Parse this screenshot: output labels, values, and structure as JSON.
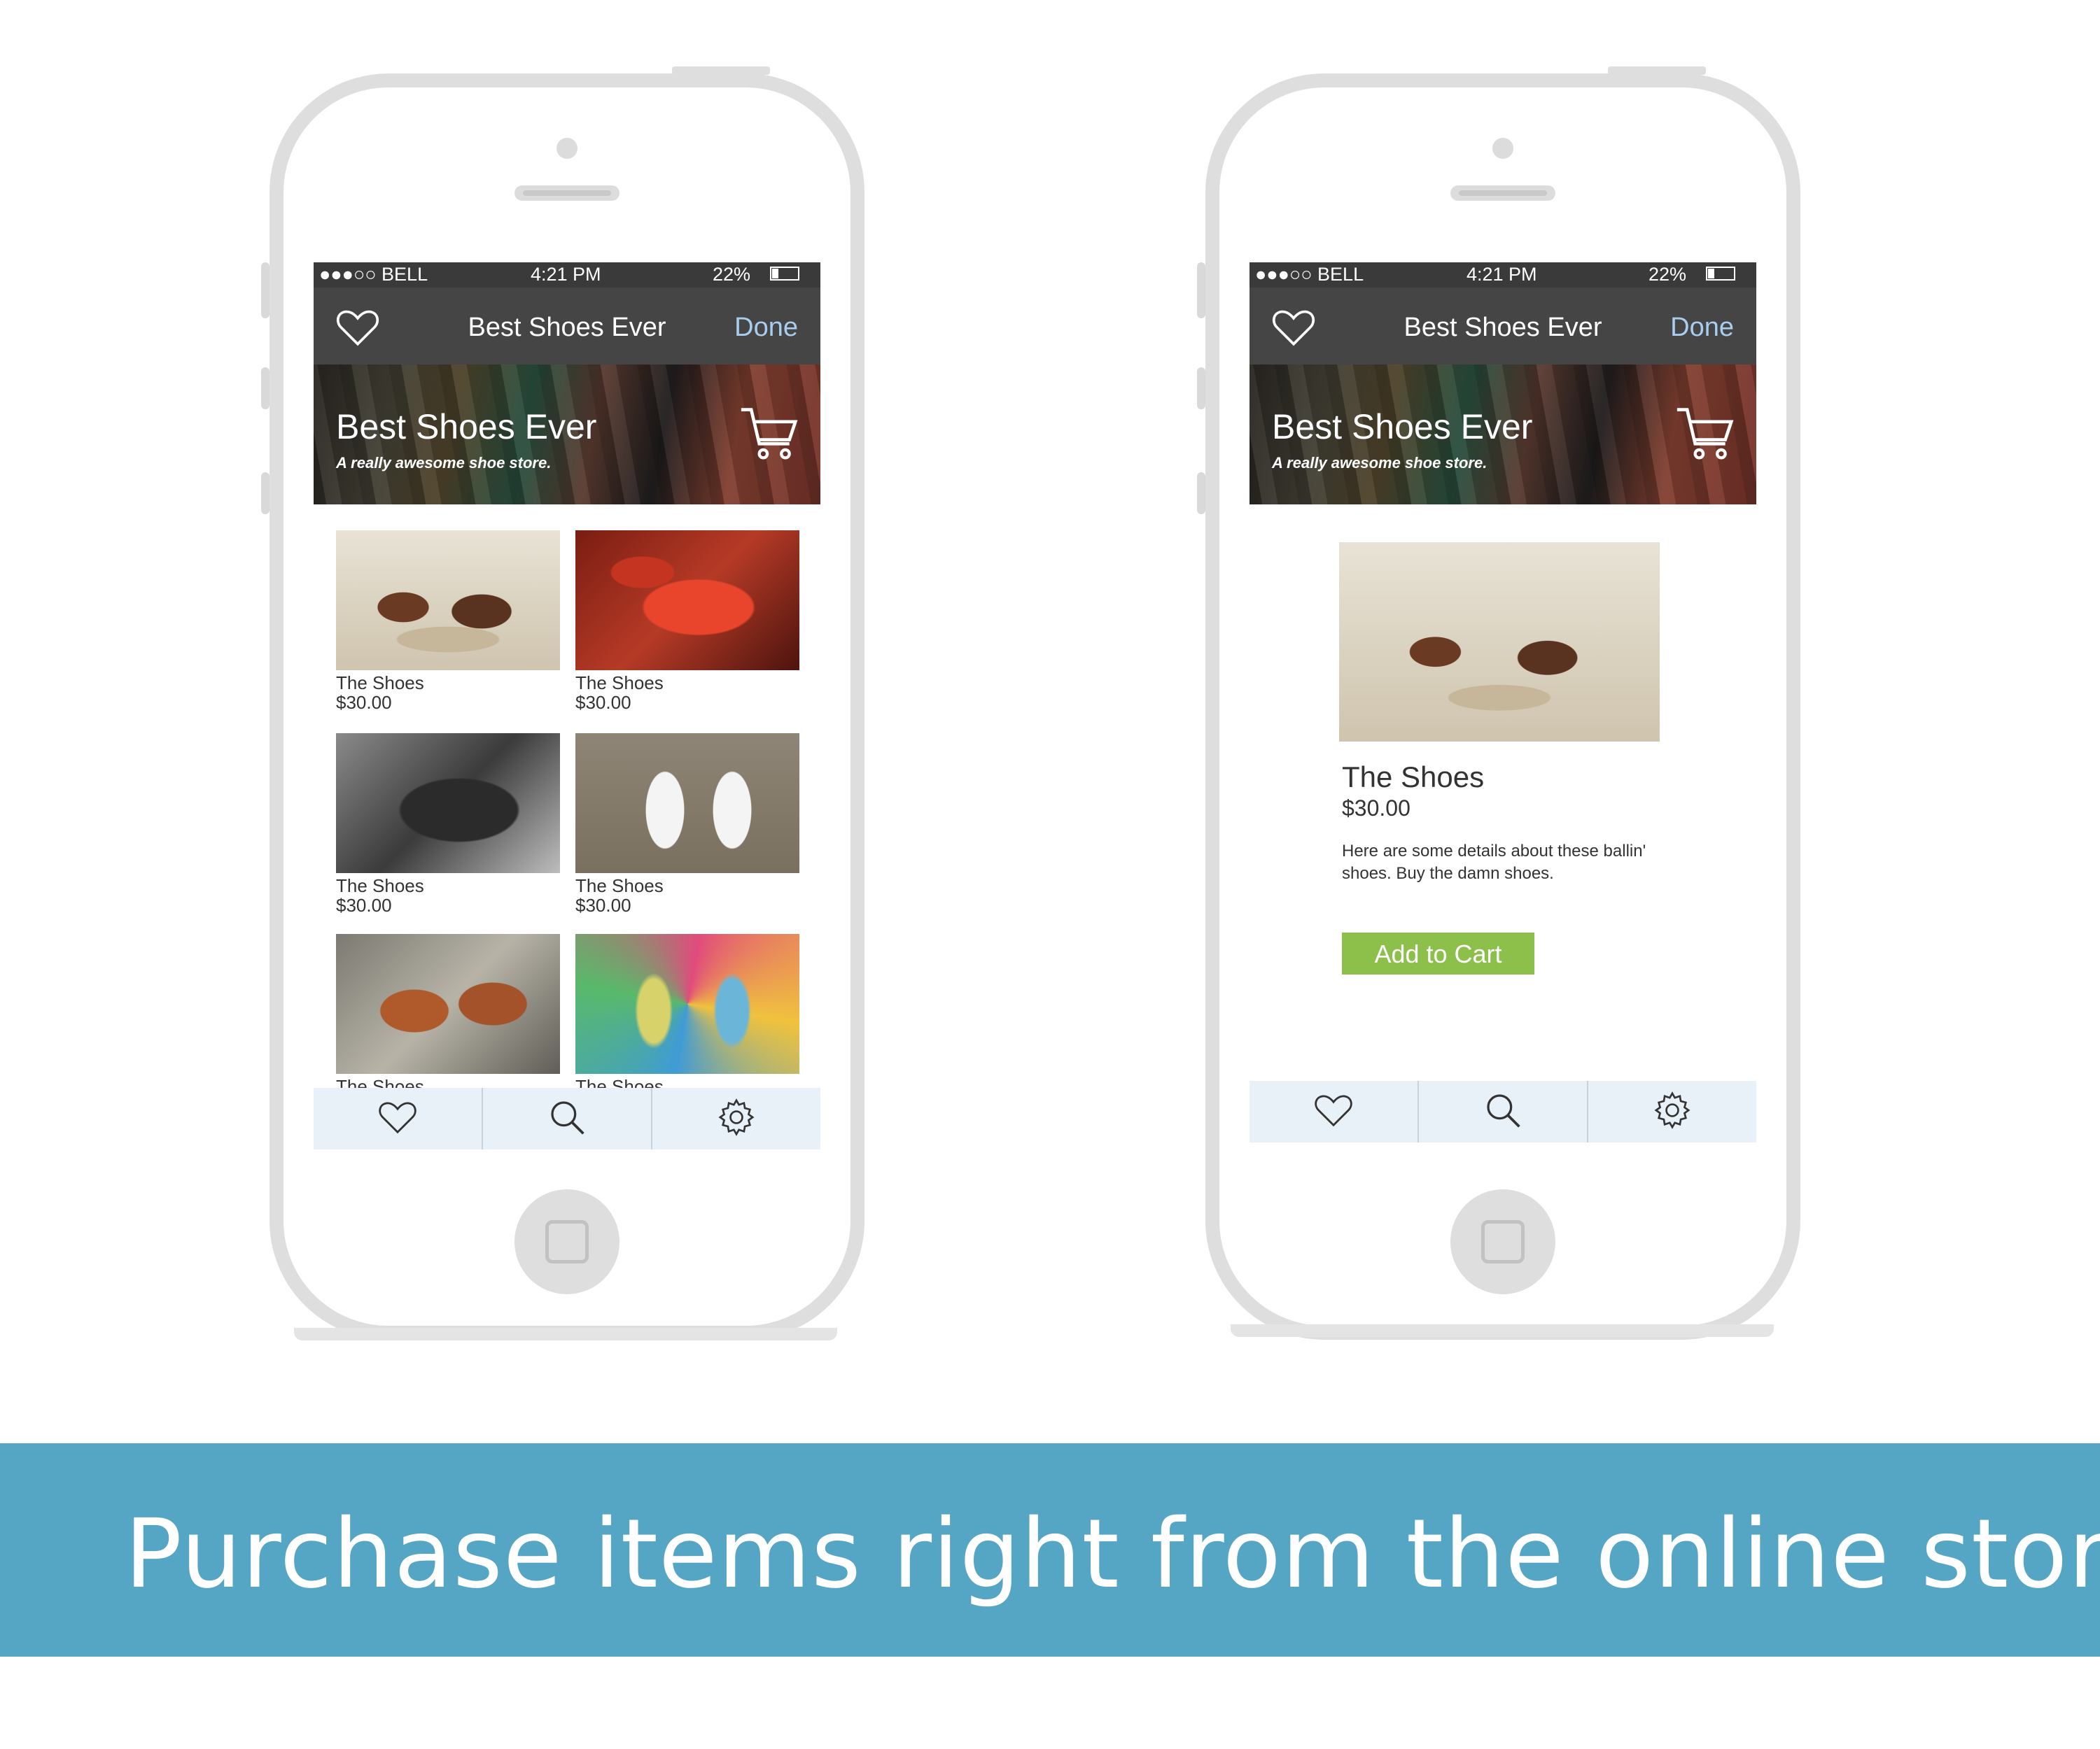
{
  "status_bar": {
    "carrier": "●●●○○ BELL",
    "time": "4:21 PM",
    "battery": "22%"
  },
  "nav": {
    "title": "Best Shoes Ever",
    "done": "Done"
  },
  "banner": {
    "title": "Best Shoes Ever",
    "subtitle": "A really awesome shoe store."
  },
  "products": [
    {
      "name": "The Shoes",
      "price": "$30.00"
    },
    {
      "name": "The Shoes",
      "price": "$30.00"
    },
    {
      "name": "The Shoes",
      "price": "$30.00"
    },
    {
      "name": "The Shoes",
      "price": "$30.00"
    },
    {
      "name": "The Shoes"
    },
    {
      "name": "The Shoes"
    }
  ],
  "detail": {
    "name": "The Shoes",
    "price": "$30.00",
    "description": "Here are some details about these ballin' shoes. Buy the damn shoes.",
    "add_to_cart": "Add to Cart"
  },
  "tabs": [
    {
      "icon": "heart-icon"
    },
    {
      "icon": "search-icon"
    },
    {
      "icon": "gear-icon"
    }
  ],
  "caption": "Purchase items right from the online store.",
  "colors": {
    "accent_done": "#a8cdef",
    "add_to_cart": "#8dc04a",
    "footer_band": "#55a5c4",
    "tabbar": "#e8f1f8"
  }
}
